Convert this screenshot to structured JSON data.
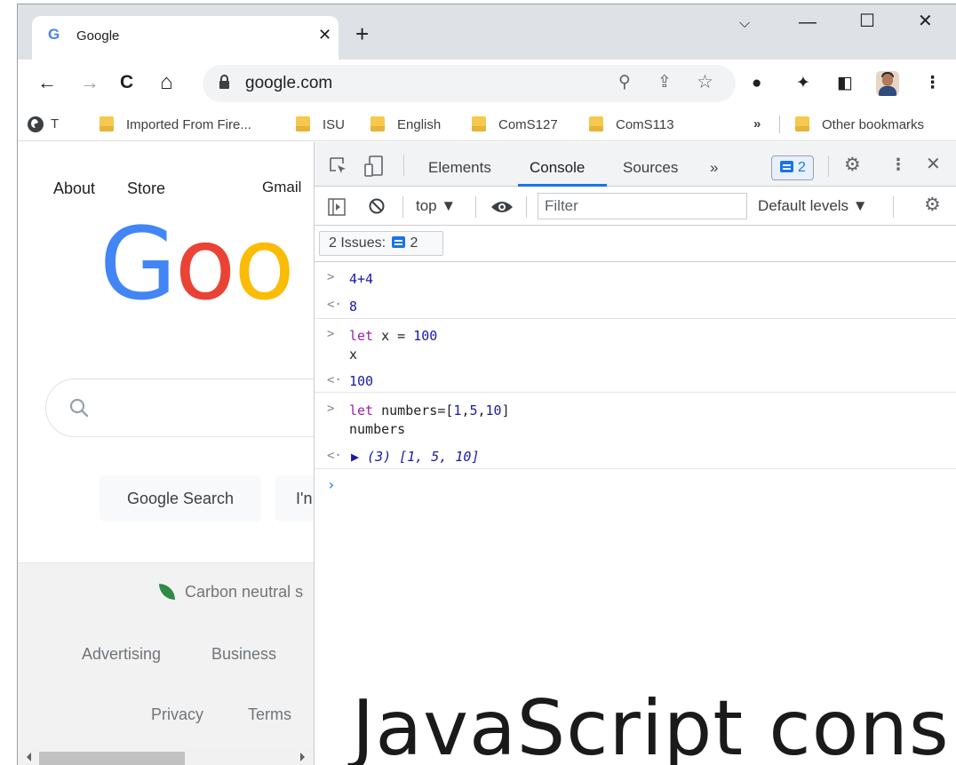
{
  "browser": {
    "tab": {
      "title": "Google",
      "favicon": "G"
    },
    "new_tab_glyph": "+",
    "window_controls": {
      "minimize": "—",
      "maximize": "☐",
      "close": "✕",
      "tab_search": "⌵"
    },
    "nav": {
      "back": "←",
      "forward": "→",
      "reload": "C",
      "home": "⌂"
    },
    "address": "google.com",
    "omnibox_icons": [
      "search-icon",
      "share-icon",
      "star-icon"
    ],
    "extension_icons": [
      "extensions-icon",
      "puzzle-icon",
      "side-panel-icon",
      "avatar",
      "kebab-menu-icon"
    ],
    "bookmarks": [
      {
        "label": "T",
        "type": "site"
      },
      {
        "label": "Imported From Fire...",
        "type": "folder"
      },
      {
        "label": "ISU",
        "type": "folder"
      },
      {
        "label": "English",
        "type": "folder"
      },
      {
        "label": "ComS127",
        "type": "folder"
      },
      {
        "label": "ComS113",
        "type": "folder"
      }
    ],
    "bookmarks_overflow": "»",
    "other_bookmarks": "Other bookmarks"
  },
  "page": {
    "top_links": {
      "about": "About",
      "store": "Store",
      "gmail": "Gmail"
    },
    "logo": [
      "G",
      "o",
      "o"
    ],
    "buttons": {
      "search": "Google Search",
      "lucky": "I'n"
    },
    "footer": {
      "carbon": "Carbon neutral s",
      "advertising": "Advertising",
      "business": "Business",
      "privacy": "Privacy",
      "terms": "Terms"
    }
  },
  "devtools": {
    "tabs": [
      "Elements",
      "Console",
      "Sources"
    ],
    "active_tab": "Console",
    "more_tabs": "»",
    "issues_count": "2",
    "context": "top ▼",
    "filter_placeholder": "Filter",
    "levels": "Default levels ▼",
    "issues_label": "2 Issues:",
    "console": [
      {
        "input": [
          "4+4"
        ],
        "output": "8"
      },
      {
        "input": [
          "let x = 100",
          "x"
        ],
        "output": "100"
      },
      {
        "input": [
          "let numbers=[1,5,10]",
          "numbers"
        ],
        "output": "▶ (3) [1, 5, 10]"
      }
    ]
  },
  "overlay_title": "JavaScript cons",
  "colors": {
    "google_blue": "#4285f4",
    "google_red": "#ea4335",
    "google_yellow": "#fbbc05",
    "devtools_accent": "#1a73e8"
  }
}
